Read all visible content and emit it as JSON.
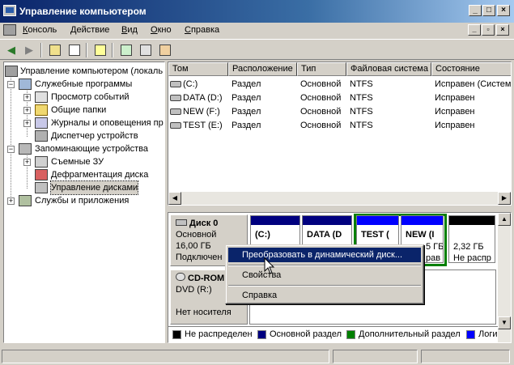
{
  "window": {
    "title": "Управление компьютером"
  },
  "menu": [
    {
      "label": "Консоль",
      "u": "К"
    },
    {
      "label": "Действие",
      "u": "Д"
    },
    {
      "label": "Вид",
      "u": "В"
    },
    {
      "label": "Окно",
      "u": "О"
    },
    {
      "label": "Справка",
      "u": "С"
    }
  ],
  "tree": {
    "root": "Управление компьютером (локаль",
    "items": [
      "Служебные программы",
      "Просмотр событий",
      "Общие папки",
      "Журналы и оповещения пр",
      "Диспетчер устройств",
      "Запоминающие устройства",
      "Съемные ЗУ",
      "Дефрагментация диска",
      "Управление дисками",
      "Службы и приложения"
    ]
  },
  "list": {
    "columns": [
      "Том",
      "Расположение",
      "Тип",
      "Файловая система",
      "Состояние"
    ],
    "rows": [
      [
        "(C:)",
        "Раздел",
        "Основной",
        "NTFS",
        "Исправен (Система)"
      ],
      [
        "DATA (D:)",
        "Раздел",
        "Основной",
        "NTFS",
        "Исправен"
      ],
      [
        "NEW (F:)",
        "Раздел",
        "Основной",
        "NTFS",
        "Исправен"
      ],
      [
        "TEST (E:)",
        "Раздел",
        "Основной",
        "NTFS",
        "Исправен"
      ]
    ]
  },
  "disks": {
    "disk0": {
      "name": "Диск 0",
      "type": "Основной",
      "size": "16,00 ГБ",
      "status": "Подключен"
    },
    "cdrom": {
      "name": "CD-ROM",
      "drive": "DVD (R:)",
      "status": "Нет носителя"
    },
    "volumes": [
      {
        "name": "(C:)",
        "size": "",
        "status": ""
      },
      {
        "name": "DATA (D",
        "size": "",
        "status": ""
      },
      {
        "name": "TEST (",
        "size": "",
        "status": ""
      },
      {
        "name": "NEW (I",
        "size": "5 ГБ",
        "status": "рав"
      },
      {
        "name": "",
        "size": "2,32 ГБ",
        "status": "Не распр"
      }
    ]
  },
  "legend": [
    "Не распределен",
    "Основной раздел",
    "Дополнительный раздел",
    "Логичес"
  ],
  "colors": {
    "unallocated": "#000000",
    "primary": "#00007f",
    "extended": "#007f00",
    "logical": "#0000ff",
    "selection": "#0a246a"
  },
  "context_menu": {
    "items": [
      "Преобразовать в динамический диск...",
      "Свойства",
      "Справка"
    ]
  }
}
